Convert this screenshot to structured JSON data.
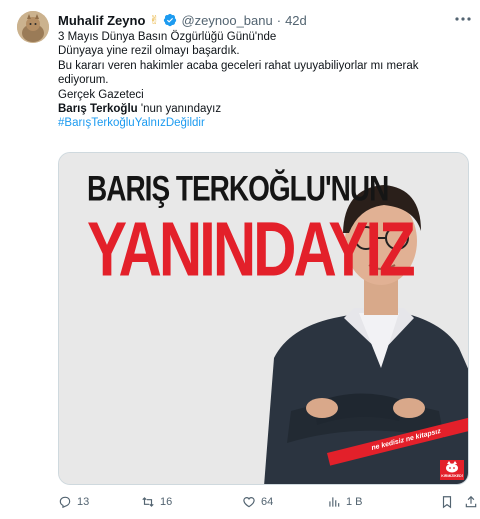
{
  "author": {
    "name": "Muhalif Zeyno",
    "emoji": "✌",
    "handle": "@zeynoo_banu",
    "separator": "·",
    "time": "42d"
  },
  "text": {
    "lines": [
      "3 Mayıs Dünya Basın Özgürlüğü Günü'nde",
      "Dünyaya yine rezil olmayı başardık.",
      "Bu kararı veren hakimler acaba geceleri rahat uyuyabiliyorlar mı merak",
      "ediyorum.",
      "Gerçek Gazeteci"
    ],
    "mention_bold": "Barış Terkoğlu",
    "mention_rest": " 'nun yanındayız",
    "hashtag": "#BarışTerkoğluYalnızDeğildir"
  },
  "media": {
    "headline_top": "BARIŞ TERKOĞLU'NUN",
    "headline_main": "YANINDAYIZ",
    "ribbon_text": "ne kedisiz ne kitapsız",
    "brand_text": "KIRMIZIKEDİ"
  },
  "actions": {
    "replies": "13",
    "retweets": "16",
    "likes": "64",
    "views": "1 B"
  },
  "colors": {
    "accent": "#1d9bf0",
    "headline_red": "#e3202a",
    "muted": "#536471"
  }
}
